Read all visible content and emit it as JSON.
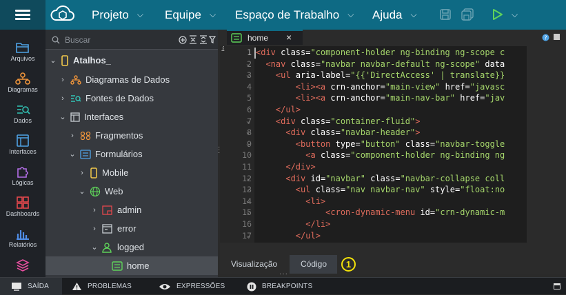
{
  "menu": {
    "items": [
      {
        "label": "Projeto"
      },
      {
        "label": "Equipe"
      },
      {
        "label": "Espaço de Trabalho"
      },
      {
        "label": "Ajuda"
      }
    ]
  },
  "left": {
    "items": [
      {
        "label": "Arquivos",
        "icon": "folder-icon"
      },
      {
        "label": "Diagramas",
        "icon": "diagram-icon"
      },
      {
        "label": "Dados",
        "icon": "data-icon"
      },
      {
        "label": "Interfaces",
        "icon": "interfaces-icon"
      },
      {
        "label": "Lógicas",
        "icon": "puzzle-icon"
      },
      {
        "label": "Dashboards",
        "icon": "dashboard-icon"
      },
      {
        "label": "Relatórios",
        "icon": "reports-icon"
      }
    ]
  },
  "search": {
    "placeholder": "Buscar"
  },
  "tree": {
    "nodes": [
      {
        "label": "Atalhos_"
      },
      {
        "label": "Diagramas de Dados"
      },
      {
        "label": "Fontes de Dados"
      },
      {
        "label": "Interfaces"
      },
      {
        "label": "Fragmentos"
      },
      {
        "label": "Formulários"
      },
      {
        "label": "Mobile"
      },
      {
        "label": "Web"
      },
      {
        "label": "admin"
      },
      {
        "label": "error"
      },
      {
        "label": "logged"
      },
      {
        "label": "home"
      }
    ]
  },
  "editor": {
    "tab_label": "home",
    "tab_close": "×",
    "line_numbers": [
      "1",
      "2",
      "3",
      "4",
      "5",
      "6",
      "7",
      "8",
      "9",
      "10",
      "11",
      "12",
      "13",
      "14",
      "15",
      "16",
      "17"
    ]
  },
  "code": {
    "lines": [
      [
        [
          "t",
          "<div "
        ],
        [
          "a",
          "class"
        ],
        [
          "a",
          "="
        ],
        [
          "s",
          "\"component-holder ng-binding ng-scope c"
        ]
      ],
      [
        [
          "a",
          "  "
        ],
        [
          "t",
          "<nav "
        ],
        [
          "a",
          "class"
        ],
        [
          "a",
          "="
        ],
        [
          "s",
          "\"navbar navbar-default ng-scope\""
        ],
        [
          "a",
          " data"
        ]
      ],
      [
        [
          "a",
          "    "
        ],
        [
          "t",
          "<ul "
        ],
        [
          "a",
          "aria-label"
        ],
        [
          "a",
          "="
        ],
        [
          "s",
          "\"{{'DirectAccess' | translate}}"
        ]
      ],
      [
        [
          "a",
          "        "
        ],
        [
          "t",
          "<li><a "
        ],
        [
          "a",
          "crn-anchor"
        ],
        [
          "a",
          "="
        ],
        [
          "s",
          "\"main-view\""
        ],
        [
          "a",
          " href"
        ],
        [
          "a",
          "="
        ],
        [
          "s",
          "\"javasc"
        ]
      ],
      [
        [
          "a",
          "        "
        ],
        [
          "t",
          "<li><a "
        ],
        [
          "a",
          "crn-anchor"
        ],
        [
          "a",
          "="
        ],
        [
          "s",
          "\"main-nav-bar\""
        ],
        [
          "a",
          " href"
        ],
        [
          "a",
          "="
        ],
        [
          "s",
          "\"jav"
        ]
      ],
      [
        [
          "a",
          "    "
        ],
        [
          "t",
          "</ul>"
        ]
      ],
      [
        [
          "a",
          "    "
        ],
        [
          "t",
          "<div "
        ],
        [
          "a",
          "class"
        ],
        [
          "a",
          "="
        ],
        [
          "s",
          "\"container-fluid\""
        ],
        [
          "t",
          ">"
        ]
      ],
      [
        [
          "a",
          "      "
        ],
        [
          "t",
          "<div "
        ],
        [
          "a",
          "class"
        ],
        [
          "a",
          "="
        ],
        [
          "s",
          "\"navbar-header\""
        ],
        [
          "t",
          ">"
        ]
      ],
      [
        [
          "a",
          "        "
        ],
        [
          "t",
          "<button "
        ],
        [
          "a",
          "type"
        ],
        [
          "a",
          "="
        ],
        [
          "s",
          "\"button\""
        ],
        [
          "a",
          " class"
        ],
        [
          "a",
          "="
        ],
        [
          "s",
          "\"navbar-toggle"
        ]
      ],
      [
        [
          "a",
          "          "
        ],
        [
          "t",
          "<a "
        ],
        [
          "a",
          "class"
        ],
        [
          "a",
          "="
        ],
        [
          "s",
          "\"component-holder ng-binding ng"
        ]
      ],
      [
        [
          "a",
          "      "
        ],
        [
          "t",
          "</div>"
        ]
      ],
      [
        [
          "a",
          "      "
        ],
        [
          "t",
          "<div "
        ],
        [
          "a",
          "id"
        ],
        [
          "a",
          "="
        ],
        [
          "s",
          "\"navbar\""
        ],
        [
          "a",
          " class"
        ],
        [
          "a",
          "="
        ],
        [
          "s",
          "\"navbar-collapse coll"
        ]
      ],
      [
        [
          "a",
          "        "
        ],
        [
          "t",
          "<ul "
        ],
        [
          "a",
          "class"
        ],
        [
          "a",
          "="
        ],
        [
          "s",
          "\"nav navbar-nav\""
        ],
        [
          "a",
          " style"
        ],
        [
          "a",
          "="
        ],
        [
          "s",
          "\"float:no"
        ]
      ],
      [
        [
          "a",
          "          "
        ],
        [
          "t",
          "<li>"
        ]
      ],
      [
        [
          "a",
          "              "
        ],
        [
          "t",
          "<cron-dynamic-menu "
        ],
        [
          "a",
          "id"
        ],
        [
          "a",
          "="
        ],
        [
          "s",
          "\"crn-dynamic-m"
        ]
      ],
      [
        [
          "a",
          "          "
        ],
        [
          "t",
          "</li>"
        ]
      ],
      [
        [
          "a",
          "        "
        ],
        [
          "t",
          "</ul>"
        ]
      ]
    ]
  },
  "bottom_tabs": {
    "preview": "Visualização",
    "code": "Código",
    "badge": "1"
  },
  "status": {
    "items": [
      {
        "label": "SAÍDA"
      },
      {
        "label": "PROBLEMAS"
      },
      {
        "label": "EXPRESSÕES"
      },
      {
        "label": "BREAKPOINTS"
      }
    ]
  },
  "colors": {
    "topbar": "#0e6a84",
    "accent_yellow": "#f2e10a",
    "tag": "#e06c5c",
    "string": "#a5d66b"
  }
}
